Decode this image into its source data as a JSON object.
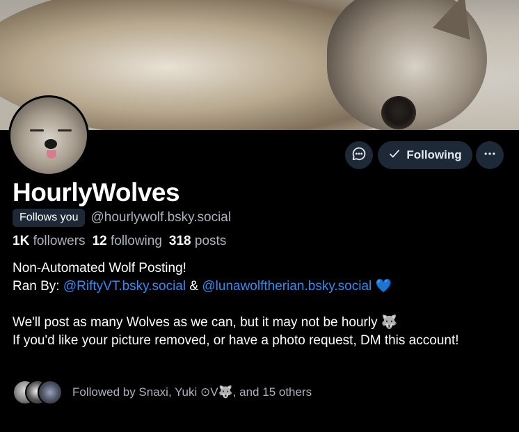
{
  "profile": {
    "display_name": "HourlyWolves",
    "follows_you_label": "Follows you",
    "handle": "@hourlywolf.bsky.social",
    "followers_count": "1K",
    "followers_label": "followers",
    "following_count": "12",
    "following_label": "following",
    "posts_count": "318",
    "posts_label": "posts"
  },
  "actions": {
    "message_icon": "chat-bubble-icon",
    "following_label": "Following",
    "following_icon": "checkmark-icon",
    "more_icon": "ellipsis-icon"
  },
  "bio": {
    "line1": "Non-Automated Wolf Posting!",
    "line2_prefix": "Ran By: ",
    "link1": "@RiftyVT.bsky.social",
    "amp": " & ",
    "link2": "@lunawolftherian.bsky.social",
    "heart": "💙",
    "line3": "We'll post as many Wolves as we can, but it may not be hourly 🐺",
    "line4": "If you'd like your picture removed, or have a photo request, DM this account!"
  },
  "followed_by": {
    "text": "Followed by Snaxi, Yuki ⊙V🐺, and 15 others"
  },
  "colors": {
    "background": "#000000",
    "button_bg": "#1e2937",
    "link": "#2f8cf6",
    "muted_text": "#aab3bf"
  }
}
